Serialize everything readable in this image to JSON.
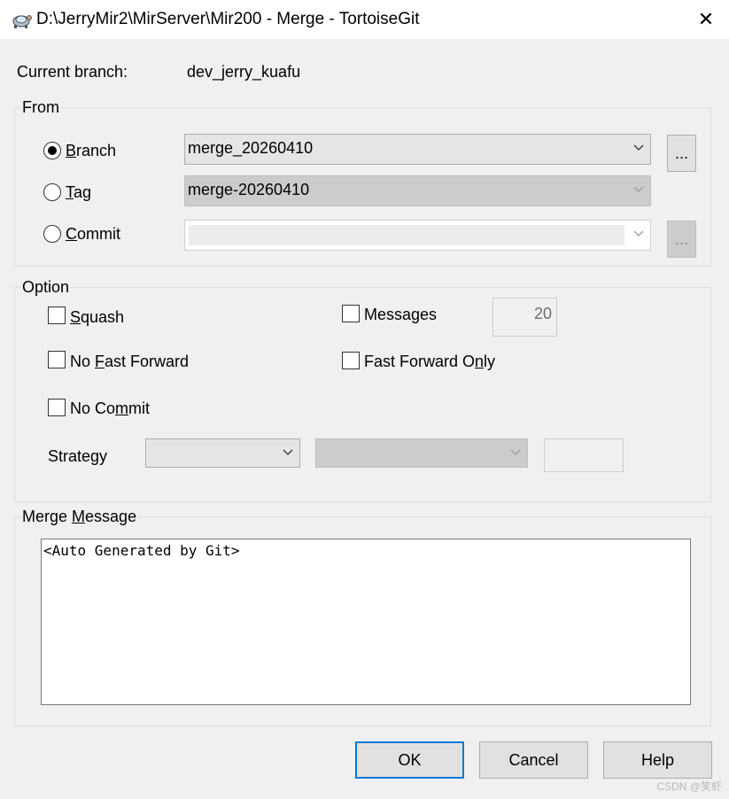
{
  "window": {
    "title": "D:\\JerryMir2\\MirServer\\Mir200 - Merge - TortoiseGit",
    "close_glyph": "✕"
  },
  "current_branch": {
    "label": "Current branch:",
    "value": "dev_jerry_kuafu"
  },
  "from": {
    "legend": "From",
    "branch": {
      "prefix": "",
      "mnemonic": "B",
      "suffix": "ranch",
      "value": "merge_20260410",
      "selected": true
    },
    "tag": {
      "prefix": "",
      "mnemonic": "T",
      "suffix": "ag",
      "value": "merge-20260410",
      "selected": false
    },
    "commit": {
      "prefix": "",
      "mnemonic": "C",
      "suffix": "ommit",
      "value": "",
      "selected": false
    },
    "browse_label": "..."
  },
  "option": {
    "legend": "Option",
    "squash": {
      "prefix": "",
      "mnemonic": "S",
      "suffix": "quash",
      "checked": false
    },
    "no_fast_forward": {
      "prefix": "No ",
      "mnemonic": "F",
      "suffix": "ast Forward",
      "checked": false
    },
    "no_commit": {
      "prefix": "No Co",
      "mnemonic": "m",
      "suffix": "mit",
      "checked": false
    },
    "messages": {
      "label": "Messages",
      "checked": false,
      "count": "20"
    },
    "fast_forward_only": {
      "prefix": "Fast Forward O",
      "mnemonic": "n",
      "suffix": "ly",
      "checked": false
    },
    "strategy": {
      "label": "Strategy",
      "value": "",
      "option_value": "",
      "extra_value": ""
    }
  },
  "merge_message": {
    "legend_prefix": "Merge ",
    "legend_mnemonic": "M",
    "legend_suffix": "essage",
    "text": "<Auto Generated by Git>"
  },
  "buttons": {
    "ok": "OK",
    "cancel": "Cancel",
    "help": "Help"
  },
  "watermark": "CSDN @笑虾"
}
